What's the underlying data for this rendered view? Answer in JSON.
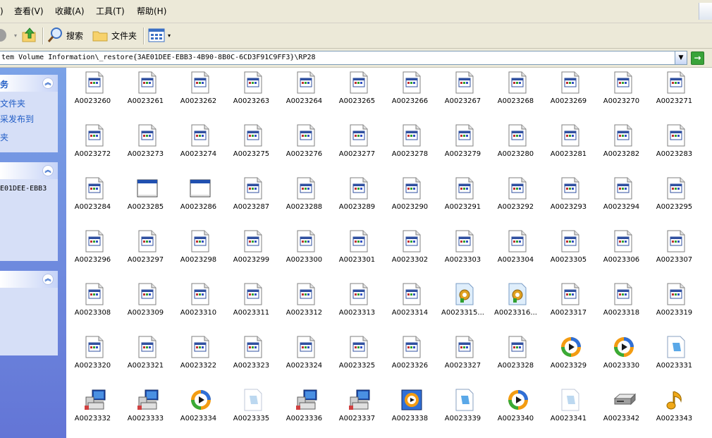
{
  "menu": {
    "edge_paren": ")",
    "items": [
      "查看(V)",
      "收藏(A)",
      "工具(T)",
      "帮助(H)"
    ]
  },
  "toolbar": {
    "search_label": "搜索",
    "folders_label": "文件夹"
  },
  "address": {
    "path": "tem Volume Information\\_restore{3AE01DEE-EBB3-4B90-8B0C-6CD3F91C9FF3}\\RP28"
  },
  "taskpane": {
    "panel1": {
      "title": "务",
      "links": [
        "文件夹",
        "采发布到",
        "夹"
      ]
    },
    "panel2": {
      "title": "",
      "links": [
        "E01DEE-EBB3"
      ]
    },
    "panel3": {
      "title": "",
      "links": []
    }
  },
  "files": [
    {
      "name": "A0023260",
      "icon": "registry-file-icon"
    },
    {
      "name": "A0023261",
      "icon": "registry-file-icon"
    },
    {
      "name": "A0023262",
      "icon": "registry-file-icon"
    },
    {
      "name": "A0023263",
      "icon": "registry-file-icon"
    },
    {
      "name": "A0023264",
      "icon": "registry-file-icon"
    },
    {
      "name": "A0023265",
      "icon": "registry-file-icon"
    },
    {
      "name": "A0023266",
      "icon": "registry-file-icon"
    },
    {
      "name": "A0023267",
      "icon": "registry-file-icon"
    },
    {
      "name": "A0023268",
      "icon": "registry-file-icon"
    },
    {
      "name": "A0023269",
      "icon": "registry-file-icon"
    },
    {
      "name": "A0023270",
      "icon": "registry-file-icon"
    },
    {
      "name": "A0023271",
      "icon": "registry-file-icon"
    },
    {
      "name": "A0023272",
      "icon": "registry-file-icon"
    },
    {
      "name": "A0023273",
      "icon": "registry-file-icon"
    },
    {
      "name": "A0023274",
      "icon": "registry-file-icon"
    },
    {
      "name": "A0023275",
      "icon": "registry-file-icon"
    },
    {
      "name": "A0023276",
      "icon": "registry-file-icon"
    },
    {
      "name": "A0023277",
      "icon": "registry-file-icon"
    },
    {
      "name": "A0023278",
      "icon": "registry-file-icon"
    },
    {
      "name": "A0023279",
      "icon": "registry-file-icon"
    },
    {
      "name": "A0023280",
      "icon": "registry-file-icon"
    },
    {
      "name": "A0023281",
      "icon": "registry-file-icon"
    },
    {
      "name": "A0023282",
      "icon": "registry-file-icon"
    },
    {
      "name": "A0023283",
      "icon": "registry-file-icon"
    },
    {
      "name": "A0023284",
      "icon": "registry-file-icon"
    },
    {
      "name": "A0023285",
      "icon": "window-app-icon"
    },
    {
      "name": "A0023286",
      "icon": "window-app-icon"
    },
    {
      "name": "A0023287",
      "icon": "registry-file-icon"
    },
    {
      "name": "A0023288",
      "icon": "registry-file-icon"
    },
    {
      "name": "A0023289",
      "icon": "registry-file-icon"
    },
    {
      "name": "A0023290",
      "icon": "registry-file-icon"
    },
    {
      "name": "A0023291",
      "icon": "registry-file-icon"
    },
    {
      "name": "A0023292",
      "icon": "registry-file-icon"
    },
    {
      "name": "A0023293",
      "icon": "registry-file-icon"
    },
    {
      "name": "A0023294",
      "icon": "registry-file-icon"
    },
    {
      "name": "A0023295",
      "icon": "registry-file-icon"
    },
    {
      "name": "A0023296",
      "icon": "registry-file-icon"
    },
    {
      "name": "A0023297",
      "icon": "registry-file-icon"
    },
    {
      "name": "A0023298",
      "icon": "registry-file-icon"
    },
    {
      "name": "A0023299",
      "icon": "registry-file-icon"
    },
    {
      "name": "A0023300",
      "icon": "registry-file-icon"
    },
    {
      "name": "A0023301",
      "icon": "registry-file-icon"
    },
    {
      "name": "A0023302",
      "icon": "registry-file-icon"
    },
    {
      "name": "A0023303",
      "icon": "registry-file-icon"
    },
    {
      "name": "A0023304",
      "icon": "registry-file-icon"
    },
    {
      "name": "A0023305",
      "icon": "registry-file-icon"
    },
    {
      "name": "A0023306",
      "icon": "registry-file-icon"
    },
    {
      "name": "A0023307",
      "icon": "registry-file-icon"
    },
    {
      "name": "A0023308",
      "icon": "registry-file-icon"
    },
    {
      "name": "A0023309",
      "icon": "registry-file-icon"
    },
    {
      "name": "A0023310",
      "icon": "registry-file-icon"
    },
    {
      "name": "A0023311",
      "icon": "registry-file-icon"
    },
    {
      "name": "A0023312",
      "icon": "registry-file-icon"
    },
    {
      "name": "A0023313",
      "icon": "registry-file-icon"
    },
    {
      "name": "A0023314",
      "icon": "registry-file-icon"
    },
    {
      "name": "A0023315...",
      "icon": "settings-file-icon"
    },
    {
      "name": "A0023316...",
      "icon": "settings-file-icon"
    },
    {
      "name": "A0023317",
      "icon": "registry-file-icon"
    },
    {
      "name": "A0023318",
      "icon": "registry-file-icon"
    },
    {
      "name": "A0023319",
      "icon": "registry-file-icon"
    },
    {
      "name": "A0023320",
      "icon": "registry-file-icon"
    },
    {
      "name": "A0023321",
      "icon": "registry-file-icon"
    },
    {
      "name": "A0023322",
      "icon": "registry-file-icon"
    },
    {
      "name": "A0023323",
      "icon": "registry-file-icon"
    },
    {
      "name": "A0023324",
      "icon": "registry-file-icon"
    },
    {
      "name": "A0023325",
      "icon": "registry-file-icon"
    },
    {
      "name": "A0023326",
      "icon": "registry-file-icon"
    },
    {
      "name": "A0023327",
      "icon": "registry-file-icon"
    },
    {
      "name": "A0023328",
      "icon": "registry-file-icon"
    },
    {
      "name": "A0023329",
      "icon": "media-player-icon"
    },
    {
      "name": "A0023330",
      "icon": "media-player-icon"
    },
    {
      "name": "A0023331",
      "icon": "blue-document-icon"
    },
    {
      "name": "A0023332",
      "icon": "computer-setup-icon"
    },
    {
      "name": "A0023333",
      "icon": "computer-setup-icon"
    },
    {
      "name": "A0023334",
      "icon": "media-player-icon"
    },
    {
      "name": "A0023335",
      "icon": "faded-document-icon"
    },
    {
      "name": "A0023336",
      "icon": "computer-setup-icon"
    },
    {
      "name": "A0023337",
      "icon": "computer-setup-icon"
    },
    {
      "name": "A0023338",
      "icon": "media-player-window-icon"
    },
    {
      "name": "A0023339",
      "icon": "blue-document-icon"
    },
    {
      "name": "A0023340",
      "icon": "media-player-icon"
    },
    {
      "name": "A0023341",
      "icon": "faded-document-icon"
    },
    {
      "name": "A0023342",
      "icon": "disk-drive-icon"
    },
    {
      "name": "A0023343",
      "icon": "music-note-icon"
    }
  ]
}
